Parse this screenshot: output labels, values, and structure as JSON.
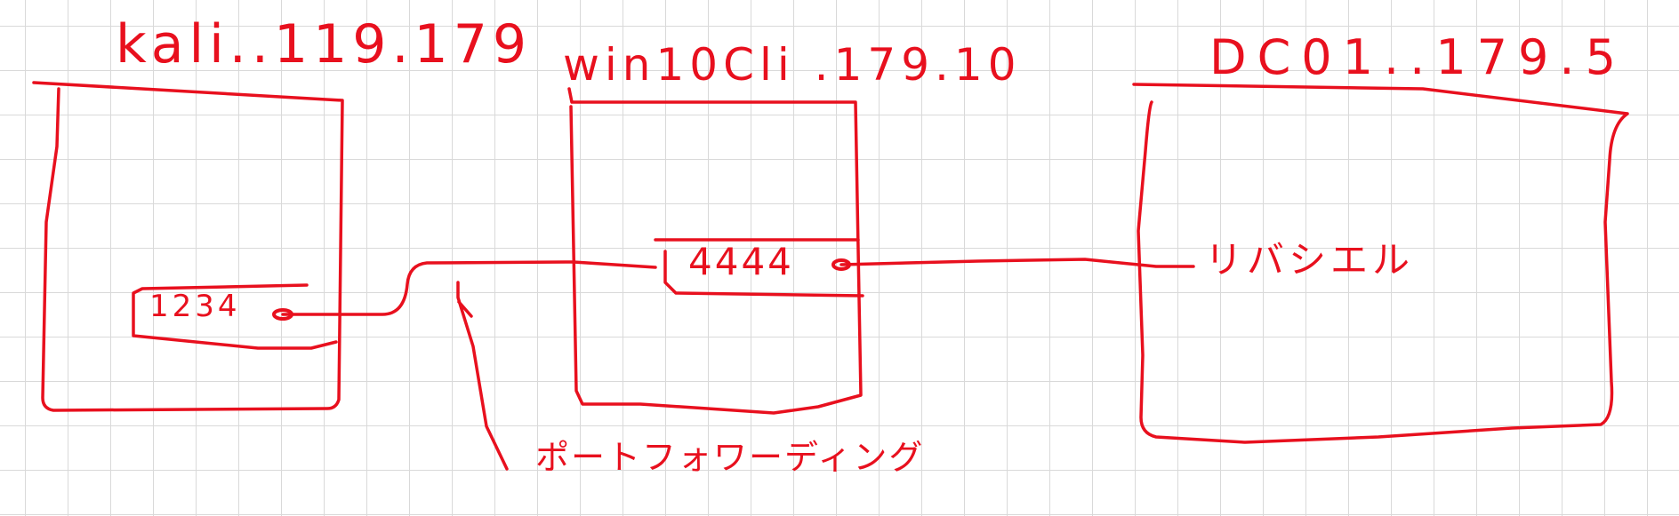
{
  "ink_color": "#e8101e",
  "hosts": [
    {
      "id": "kali",
      "label": "kali..119.179",
      "port": "1234"
    },
    {
      "id": "win10",
      "label": "win10Cli .179.10",
      "port": "4444"
    },
    {
      "id": "dc",
      "label": "DC01..179.5"
    }
  ],
  "annotations": {
    "reverse_shell": "リバシエル",
    "port_forward": "ポートフォワーディング"
  }
}
